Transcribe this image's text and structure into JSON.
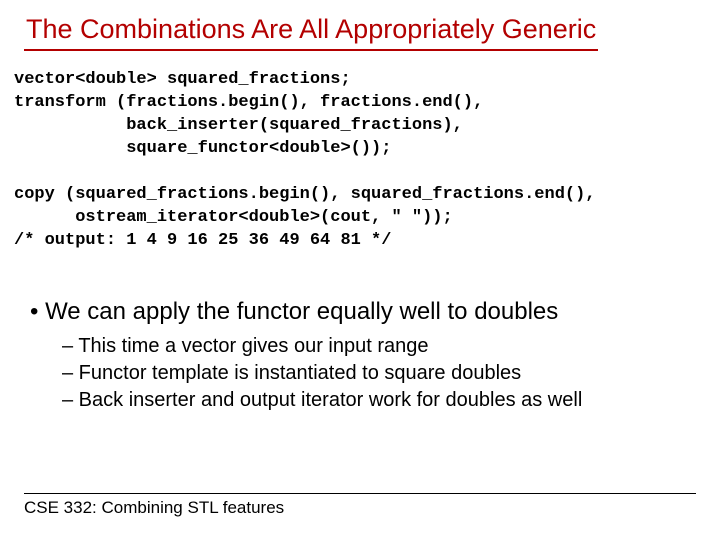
{
  "title": "The Combinations Are All Appropriately Generic",
  "code": "vector<double> squared_fractions;\ntransform (fractions.begin(), fractions.end(),\n           back_inserter(squared_fractions),\n           square_functor<double>());\n\ncopy (squared_fractions.begin(), squared_fractions.end(),\n      ostream_iterator<double>(cout, \" \"));\n/* output: 1 4 9 16 25 36 49 64 81 */",
  "bullet": "• We can apply the functor equally well to doubles",
  "subs": [
    "– This time a vector gives our input range",
    "– Functor template is instantiated to square doubles",
    "– Back inserter and output iterator work for doubles as well"
  ],
  "footer": "CSE 332: Combining STL features"
}
